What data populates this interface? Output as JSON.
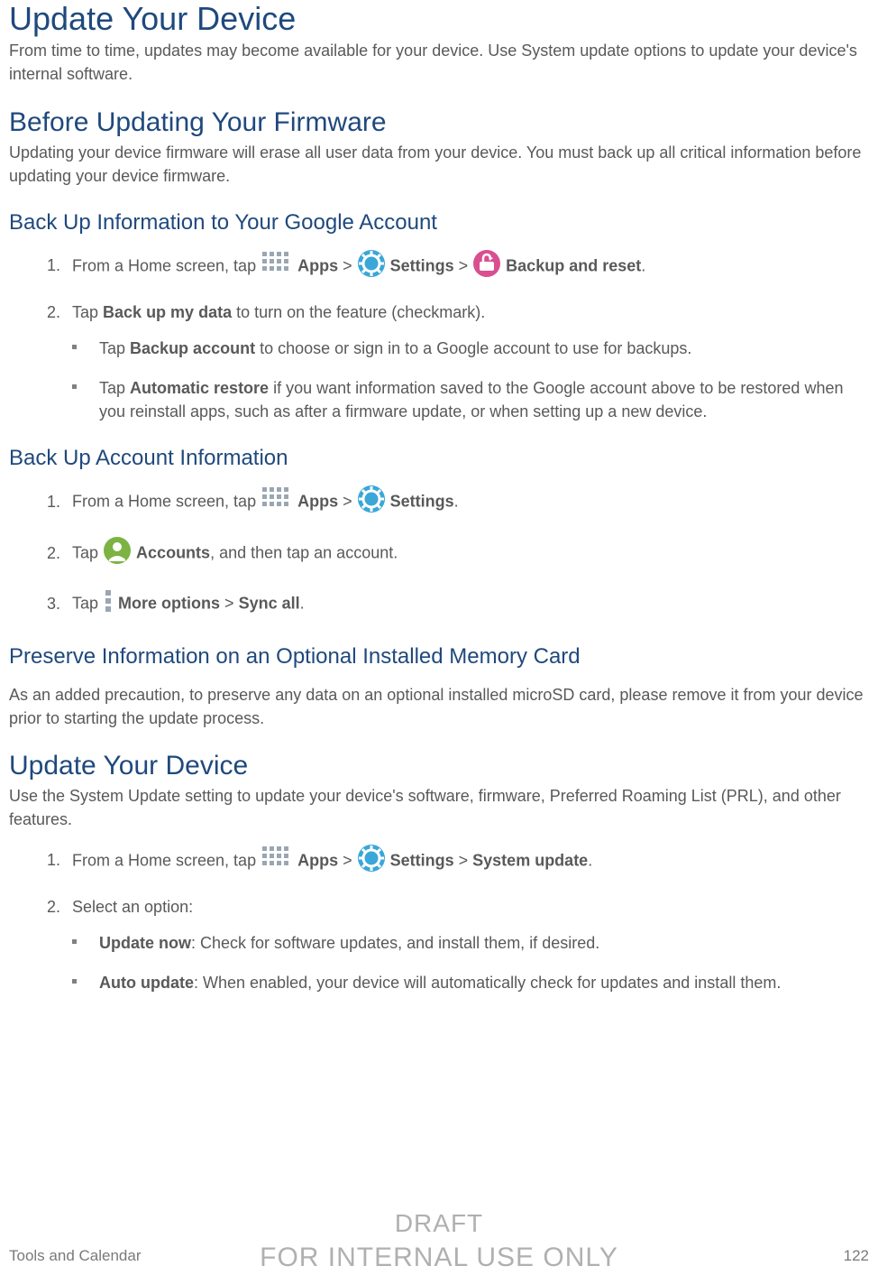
{
  "h1_1": "Update Your Device",
  "p1": "From time to time, updates may become available for your device. Use System update options to update your device's internal software.",
  "h2_1": "Before Updating Your Firmware",
  "p2": "Updating your device firmware will erase all user data from your device. You must back up all critical information before updating your device firmware.",
  "h3_1": "Back Up Information to Your Google Account",
  "s1": {
    "li1_a": "From a Home screen, tap ",
    "li1_apps": "Apps",
    "gt": " > ",
    "li1_settings": "Settings",
    "li1_backup": "Backup and reset",
    "period": ".",
    "li2_a": "Tap ",
    "li2_b": "Back up my data",
    "li2_c": " to turn on the feature (checkmark).",
    "sub1_a": "Tap ",
    "sub1_b": "Backup account",
    "sub1_c": " to choose or sign in to a Google account to use for backups.",
    "sub2_a": "Tap ",
    "sub2_b": "Automatic restore",
    "sub2_c": " if you want information saved to the Google account above to be restored when you reinstall apps, such as after a firmware update, or when setting up a new device."
  },
  "h3_2": "Back Up Account Information",
  "s2": {
    "li1_a": "From a Home screen, tap ",
    "apps": "Apps",
    "gt": " > ",
    "settings": "Settings",
    "period": ".",
    "li2_a": "Tap ",
    "li2_b": "Accounts",
    "li2_c": ", and then tap an account.",
    "li3_a": "Tap  ",
    "li3_b": "More options",
    "li3_gt": " > ",
    "li3_c": "Sync all",
    "li3_d": "."
  },
  "h3_3": "Preserve Information on an Optional Installed Memory Card",
  "p3": "As an added precaution, to preserve any data on an optional installed microSD card, please remove it from your device prior to starting the update process.",
  "h2_2": "Update Your Device",
  "p4": "Use the System Update setting to update your device's software, firmware, Preferred Roaming List (PRL), and other features.",
  "s3": {
    "li1_a": "From a Home screen, tap ",
    "apps": "Apps",
    "gt": " > ",
    "settings": "Settings",
    "gt2": " > ",
    "sysupdate": "System update",
    "period": ".",
    "li2": "Select an option:",
    "sub1_a": "Update now",
    "sub1_b": ": Check for software updates, and install them, if desired.",
    "sub2_a": "Auto update",
    "sub2_b": ": When enabled, your device will automatically check for updates and install them."
  },
  "footer": {
    "left": "Tools and Calendar",
    "right": "122"
  },
  "watermark": {
    "l1": "DRAFT",
    "l2": "FOR INTERNAL USE ONLY"
  }
}
